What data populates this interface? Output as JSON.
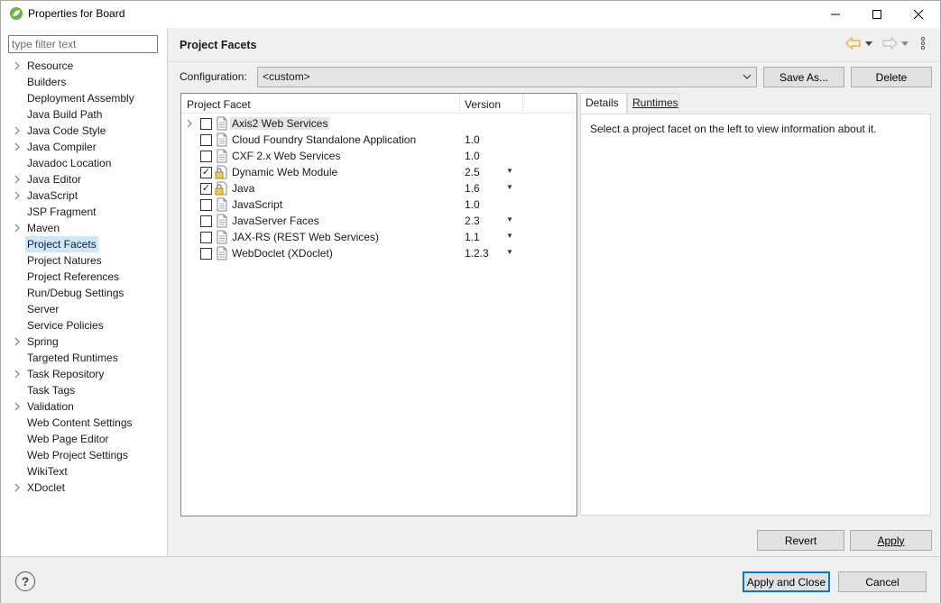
{
  "window": {
    "title": "Properties for Board"
  },
  "filter": {
    "placeholder": "type filter text"
  },
  "tree": [
    {
      "label": "Resource",
      "expandable": true
    },
    {
      "label": "Builders",
      "expandable": false
    },
    {
      "label": "Deployment Assembly",
      "expandable": false
    },
    {
      "label": "Java Build Path",
      "expandable": false
    },
    {
      "label": "Java Code Style",
      "expandable": true
    },
    {
      "label": "Java Compiler",
      "expandable": true
    },
    {
      "label": "Javadoc Location",
      "expandable": false
    },
    {
      "label": "Java Editor",
      "expandable": true
    },
    {
      "label": "JavaScript",
      "expandable": true
    },
    {
      "label": "JSP Fragment",
      "expandable": false
    },
    {
      "label": "Maven",
      "expandable": true
    },
    {
      "label": "Project Facets",
      "expandable": false,
      "selected": true
    },
    {
      "label": "Project Natures",
      "expandable": false
    },
    {
      "label": "Project References",
      "expandable": false
    },
    {
      "label": "Run/Debug Settings",
      "expandable": false
    },
    {
      "label": "Server",
      "expandable": false
    },
    {
      "label": "Service Policies",
      "expandable": false
    },
    {
      "label": "Spring",
      "expandable": true
    },
    {
      "label": "Targeted Runtimes",
      "expandable": false
    },
    {
      "label": "Task Repository",
      "expandable": true
    },
    {
      "label": "Task Tags",
      "expandable": false
    },
    {
      "label": "Validation",
      "expandable": true
    },
    {
      "label": "Web Content Settings",
      "expandable": false
    },
    {
      "label": "Web Page Editor",
      "expandable": false
    },
    {
      "label": "Web Project Settings",
      "expandable": false
    },
    {
      "label": "WikiText",
      "expandable": false
    },
    {
      "label": "XDoclet",
      "expandable": true
    }
  ],
  "page": {
    "title": "Project Facets",
    "config_label": "Configuration:",
    "config_value": "<custom>",
    "save_as": "Save As...",
    "delete": "Delete"
  },
  "facets": {
    "header_facet": "Project Facet",
    "header_version": "Version",
    "rows": [
      {
        "name": "Axis2 Web Services",
        "version": "",
        "checked": false,
        "expandable": true,
        "highlight": true,
        "dropdown": false,
        "icon": "document-icon"
      },
      {
        "name": "Cloud Foundry Standalone Application",
        "version": "1.0",
        "checked": false,
        "dropdown": false,
        "icon": "document-icon"
      },
      {
        "name": "CXF 2.x Web Services",
        "version": "1.0",
        "checked": false,
        "dropdown": false,
        "icon": "document-icon"
      },
      {
        "name": "Dynamic Web Module",
        "version": "2.5",
        "checked": true,
        "dropdown": true,
        "icon": "locked-document-icon"
      },
      {
        "name": "Java",
        "version": "1.6",
        "checked": true,
        "dropdown": true,
        "icon": "locked-document-icon"
      },
      {
        "name": "JavaScript",
        "version": "1.0",
        "checked": false,
        "dropdown": false,
        "icon": "document-icon"
      },
      {
        "name": "JavaServer Faces",
        "version": "2.3",
        "checked": false,
        "dropdown": true,
        "icon": "document-icon"
      },
      {
        "name": "JAX-RS (REST Web Services)",
        "version": "1.1",
        "checked": false,
        "dropdown": true,
        "icon": "document-icon"
      },
      {
        "name": "WebDoclet (XDoclet)",
        "version": "1.2.3",
        "checked": false,
        "dropdown": true,
        "icon": "document-icon"
      }
    ]
  },
  "details": {
    "tab_details": "Details",
    "tab_runtimes": "Runtimes",
    "message": "Select a project facet on the left to view information about it."
  },
  "buttons": {
    "revert": "Revert",
    "apply": "Apply",
    "apply_close": "Apply and Close",
    "cancel": "Cancel"
  },
  "colors": {
    "selection": "#cce8ff",
    "default_button_border": "#0078d7",
    "nav_arrow": "#e8a33c"
  }
}
